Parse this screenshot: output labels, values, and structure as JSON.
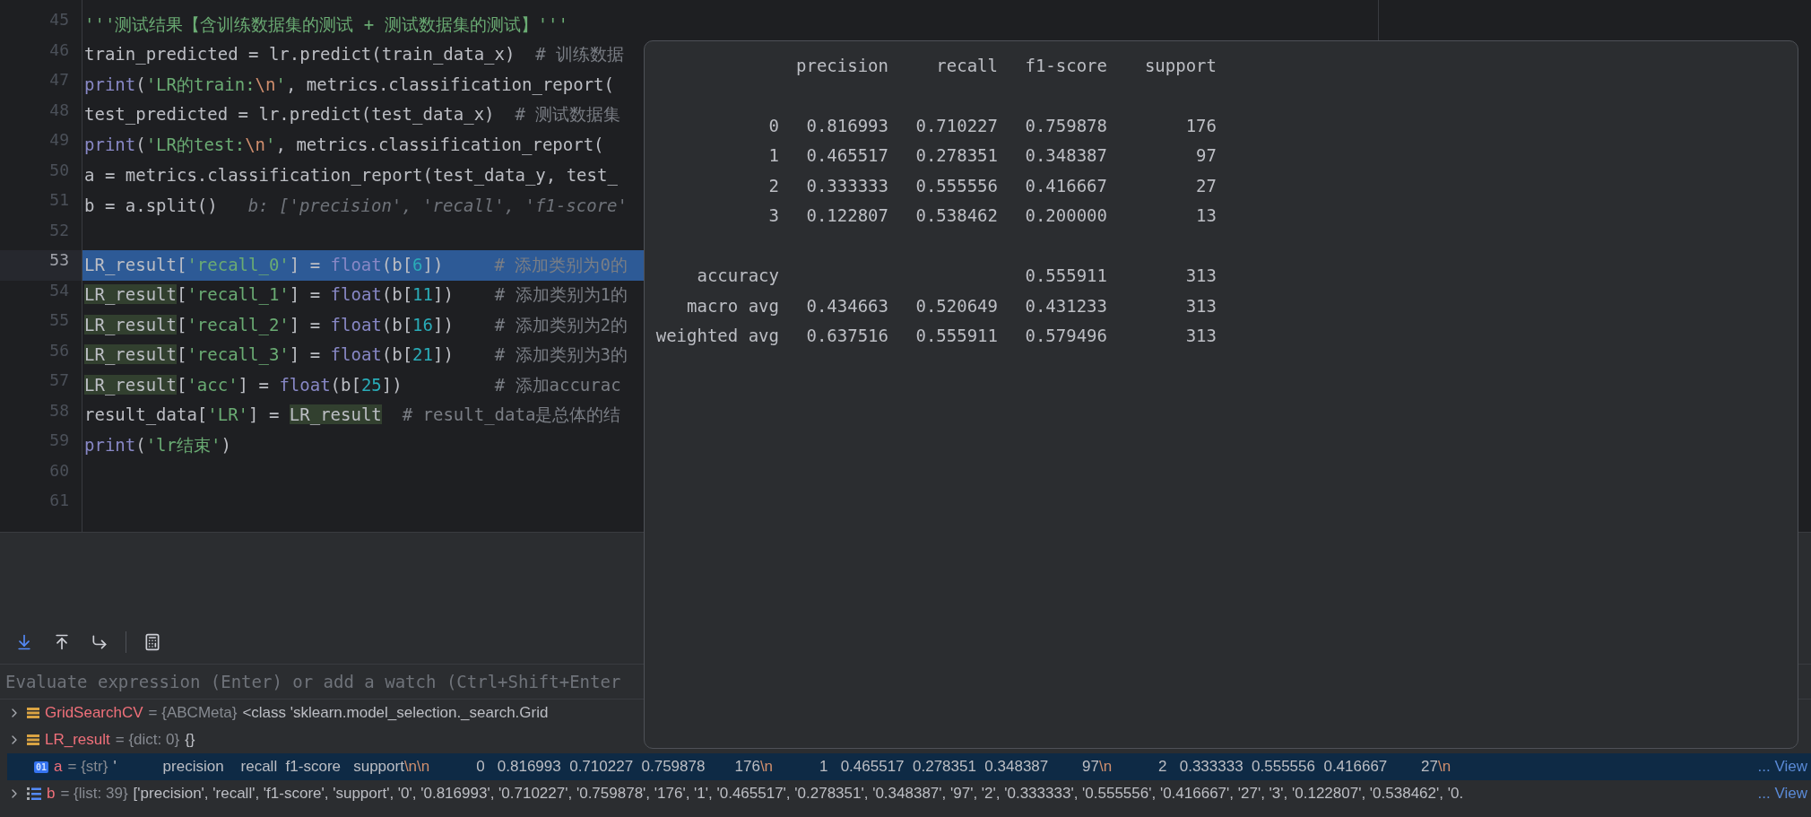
{
  "editor": {
    "lines": [
      {
        "number": "45",
        "segments": [
          {
            "kind": "string",
            "text": "'''测试结果【含训练数据集的测试 + 测试数据集的测试】'''"
          }
        ]
      },
      {
        "number": "46",
        "segments": [
          {
            "kind": "plain",
            "text": "train_predicted = lr.predict(train_data_x)  "
          },
          {
            "kind": "comment",
            "text": "# 训练数据"
          }
        ]
      },
      {
        "number": "47",
        "segments": [
          {
            "kind": "builtin",
            "text": "print"
          },
          {
            "kind": "plain",
            "text": "("
          },
          {
            "kind": "string",
            "text": "'LR的train:"
          },
          {
            "kind": "escape",
            "text": "\\n"
          },
          {
            "kind": "string",
            "text": "'"
          },
          {
            "kind": "plain",
            "text": ", metrics.classification_report("
          }
        ]
      },
      {
        "number": "48",
        "segments": [
          {
            "kind": "plain",
            "text": "test_predicted = lr.predict(test_data_x)  "
          },
          {
            "kind": "comment",
            "text": "# 测试数据集"
          }
        ]
      },
      {
        "number": "49",
        "segments": [
          {
            "kind": "builtin",
            "text": "print"
          },
          {
            "kind": "plain",
            "text": "("
          },
          {
            "kind": "string",
            "text": "'LR的test:"
          },
          {
            "kind": "escape",
            "text": "\\n"
          },
          {
            "kind": "string",
            "text": "'"
          },
          {
            "kind": "plain",
            "text": ", metrics.classification_report("
          }
        ]
      },
      {
        "number": "50",
        "segments": [
          {
            "kind": "plain",
            "text": "a = metrics.classification_report(test_data_y, test_"
          }
        ]
      },
      {
        "number": "51",
        "segments": [
          {
            "kind": "plain",
            "text": "b = a.split()"
          }
        ],
        "hint": "b: ['precision', 'recall', 'f1-score'"
      },
      {
        "number": "52"
      },
      {
        "number": "53",
        "selected": true,
        "segments": [
          {
            "kind": "plain",
            "text": "LR_result["
          },
          {
            "kind": "string",
            "text": "'recall_0'"
          },
          {
            "kind": "plain",
            "text": "] = "
          },
          {
            "kind": "builtin",
            "text": "float"
          },
          {
            "kind": "plain",
            "text": "(b["
          },
          {
            "kind": "number",
            "text": "6"
          },
          {
            "kind": "plain",
            "text": "])     "
          },
          {
            "kind": "comment",
            "text": "# 添加类别为0的"
          }
        ]
      },
      {
        "number": "54",
        "segments": [
          {
            "kind": "usage",
            "text": "LR_result"
          },
          {
            "kind": "plain",
            "text": "["
          },
          {
            "kind": "string",
            "text": "'recall_1'"
          },
          {
            "kind": "plain",
            "text": "] = "
          },
          {
            "kind": "builtin",
            "text": "float"
          },
          {
            "kind": "plain",
            "text": "(b["
          },
          {
            "kind": "number",
            "text": "11"
          },
          {
            "kind": "plain",
            "text": "])    "
          },
          {
            "kind": "comment",
            "text": "# 添加类别为1的"
          }
        ]
      },
      {
        "number": "55",
        "segments": [
          {
            "kind": "usage",
            "text": "LR_result"
          },
          {
            "kind": "plain",
            "text": "["
          },
          {
            "kind": "string",
            "text": "'recall_2'"
          },
          {
            "kind": "plain",
            "text": "] = "
          },
          {
            "kind": "builtin",
            "text": "float"
          },
          {
            "kind": "plain",
            "text": "(b["
          },
          {
            "kind": "number",
            "text": "16"
          },
          {
            "kind": "plain",
            "text": "])    "
          },
          {
            "kind": "comment",
            "text": "# 添加类别为2的"
          }
        ]
      },
      {
        "number": "56",
        "segments": [
          {
            "kind": "usage",
            "text": "LR_result"
          },
          {
            "kind": "plain",
            "text": "["
          },
          {
            "kind": "string",
            "text": "'recall_3'"
          },
          {
            "kind": "plain",
            "text": "] = "
          },
          {
            "kind": "builtin",
            "text": "float"
          },
          {
            "kind": "plain",
            "text": "(b["
          },
          {
            "kind": "number",
            "text": "21"
          },
          {
            "kind": "plain",
            "text": "])    "
          },
          {
            "kind": "comment",
            "text": "# 添加类别为3的"
          }
        ]
      },
      {
        "number": "57",
        "segments": [
          {
            "kind": "usage",
            "text": "LR_result"
          },
          {
            "kind": "plain",
            "text": "["
          },
          {
            "kind": "string",
            "text": "'acc'"
          },
          {
            "kind": "plain",
            "text": "] = "
          },
          {
            "kind": "builtin",
            "text": "float"
          },
          {
            "kind": "plain",
            "text": "(b["
          },
          {
            "kind": "number",
            "text": "25"
          },
          {
            "kind": "plain",
            "text": "])         "
          },
          {
            "kind": "comment",
            "text": "# 添加accurac"
          }
        ]
      },
      {
        "number": "58",
        "segments": [
          {
            "kind": "plain",
            "text": "result_data["
          },
          {
            "kind": "string",
            "text": "'LR'"
          },
          {
            "kind": "plain",
            "text": "] = "
          },
          {
            "kind": "usage",
            "text": "LR_result"
          },
          {
            "kind": "comment",
            "text": "  # result_data是总体的结"
          }
        ]
      },
      {
        "number": "59",
        "segments": [
          {
            "kind": "builtin",
            "text": "print"
          },
          {
            "kind": "plain",
            "text": "("
          },
          {
            "kind": "string",
            "text": "'lr结束'"
          },
          {
            "kind": "plain",
            "text": ")"
          }
        ]
      },
      {
        "number": "60"
      },
      {
        "number": "61"
      }
    ]
  },
  "popup": {
    "columns": [
      "precision",
      "recall",
      "f1-score",
      "support"
    ],
    "groups": [
      [
        {
          "label": "0",
          "cells": [
            "0.816993",
            "0.710227",
            "0.759878",
            "176"
          ]
        },
        {
          "label": "1",
          "cells": [
            "0.465517",
            "0.278351",
            "0.348387",
            "97"
          ]
        },
        {
          "label": "2",
          "cells": [
            "0.333333",
            "0.555556",
            "0.416667",
            "27"
          ]
        },
        {
          "label": "3",
          "cells": [
            "0.122807",
            "0.538462",
            "0.200000",
            "13"
          ]
        }
      ],
      [
        {
          "label": "accuracy",
          "cells": [
            null,
            null,
            "0.555911",
            "313"
          ]
        },
        {
          "label": "macro avg",
          "cells": [
            "0.434663",
            "0.520649",
            "0.431233",
            "313"
          ]
        },
        {
          "label": "weighted avg",
          "cells": [
            "0.637516",
            "0.555911",
            "0.579496",
            "313"
          ]
        }
      ]
    ]
  },
  "debugger": {
    "toolbar": [
      {
        "kind": "download"
      },
      {
        "kind": "upload"
      },
      {
        "kind": "step"
      },
      {
        "kind": "separator"
      },
      {
        "kind": "calculator"
      }
    ],
    "evaluate": {
      "placeholder": "Evaluate expression (Enter) or add a watch (Ctrl+Shift+Enter"
    },
    "variables": [
      {
        "expandable": true,
        "selected": false,
        "kind": "class",
        "name": "GridSearchCV",
        "type": "= {ABCMeta}",
        "value": [
          {
            "kind": "plain",
            "text": "<class 'sklearn.model_selection._search.Grid"
          }
        ]
      },
      {
        "expandable": true,
        "selected": false,
        "kind": "class",
        "name": "LR_result",
        "type": "= {dict: 0}",
        "value": [
          {
            "kind": "plain",
            "text": "{}"
          }
        ]
      },
      {
        "expandable": false,
        "selected": true,
        "kind": "str",
        "badge": "01",
        "name": "a",
        "type": "= {str}",
        "value": [
          {
            "kind": "plain",
            "text": "'           precision    recall  f1-score   support"
          },
          {
            "kind": "escape",
            "text": "\\n\\n"
          },
          {
            "kind": "plain",
            "text": "           0   0.816993  0.710227  0.759878       176"
          },
          {
            "kind": "escape",
            "text": "\\n"
          },
          {
            "kind": "plain",
            "text": "           1   0.465517  0.278351  0.348387        97"
          },
          {
            "kind": "escape",
            "text": "\\n"
          },
          {
            "kind": "plain",
            "text": "           2   0.333333  0.555556  0.416667        27"
          },
          {
            "kind": "escape",
            "text": "\\n"
          }
        ],
        "link": "... View"
      },
      {
        "expandable": true,
        "selected": false,
        "kind": "list",
        "name": "b",
        "type": "= {list: 39}",
        "value": [
          {
            "kind": "plain",
            "text": "['precision', 'recall', 'f1-score', 'support', '0', '0.816993', '0.710227', '0.759878', '176', '1', '0.465517', '0.278351', '0.348387', '97', '2', '0.333333', '0.555556', '0.416667', '27', '3', '0.122807', '0.538462', '0."
          }
        ],
        "link": "... View"
      }
    ]
  }
}
